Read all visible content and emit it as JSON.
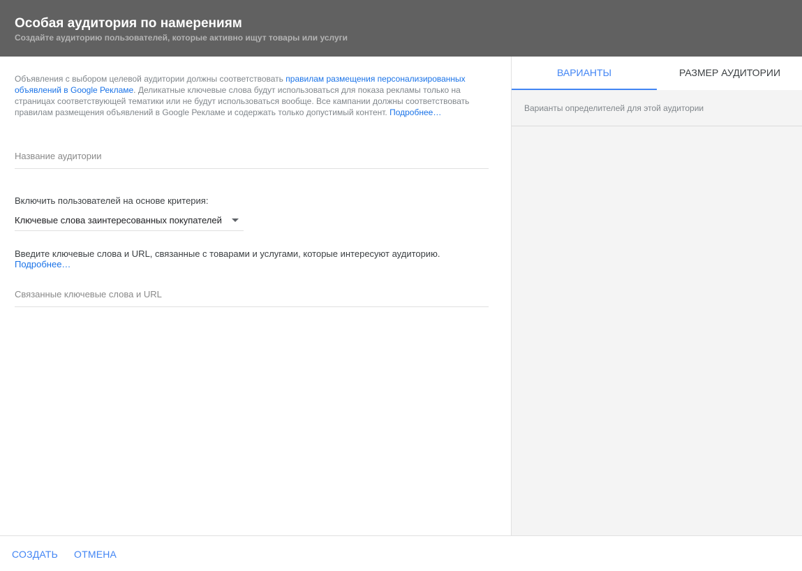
{
  "header": {
    "title": "Особая аудитория по намерениям",
    "subtitle": "Создайте аудиторию пользователей, которые активно ищут товары или услуги"
  },
  "policy": {
    "text_before": "Объявления с выбором целевой аудитории должны соответствовать ",
    "link_policy": "правилам размещения персонализированных объявлений в Google Рекламе",
    "text_after": ". Деликатные ключевые слова будут использоваться для показа рекламы только на страницах соответствующей тематики или не будут использоваться вообще. Все кампании должны соответствовать правилам размещения объявлений в Google Рекламе и содержать только допустимый контент. ",
    "link_more": "Подробнее…"
  },
  "audience_name": {
    "placeholder": "Название аудитории",
    "value": ""
  },
  "criteria": {
    "label": "Включить пользователей на основе критерия:",
    "selected": "Ключевые слова заинтересованных покупателей"
  },
  "keywords": {
    "help": "Введите ключевые слова и URL, связанные с товарами и услугами, которые интересуют аудиторию.",
    "link_more": "Подробнее…",
    "placeholder": "Связанные ключевые слова и URL",
    "value": ""
  },
  "side_panel": {
    "tabs": [
      {
        "label": "ВАРИАНТЫ",
        "active": true
      },
      {
        "label": "РАЗМЕР АУДИТОРИИ",
        "active": false
      }
    ],
    "variants_description": "Варианты определителей для этой аудитории"
  },
  "footer": {
    "create_label": "СОЗДАТЬ",
    "cancel_label": "ОТМЕНА"
  },
  "colors": {
    "header_bg": "#616161",
    "accent": "#4285f4",
    "link": "#1a73e8",
    "panel_bg": "#f4f4f4"
  }
}
